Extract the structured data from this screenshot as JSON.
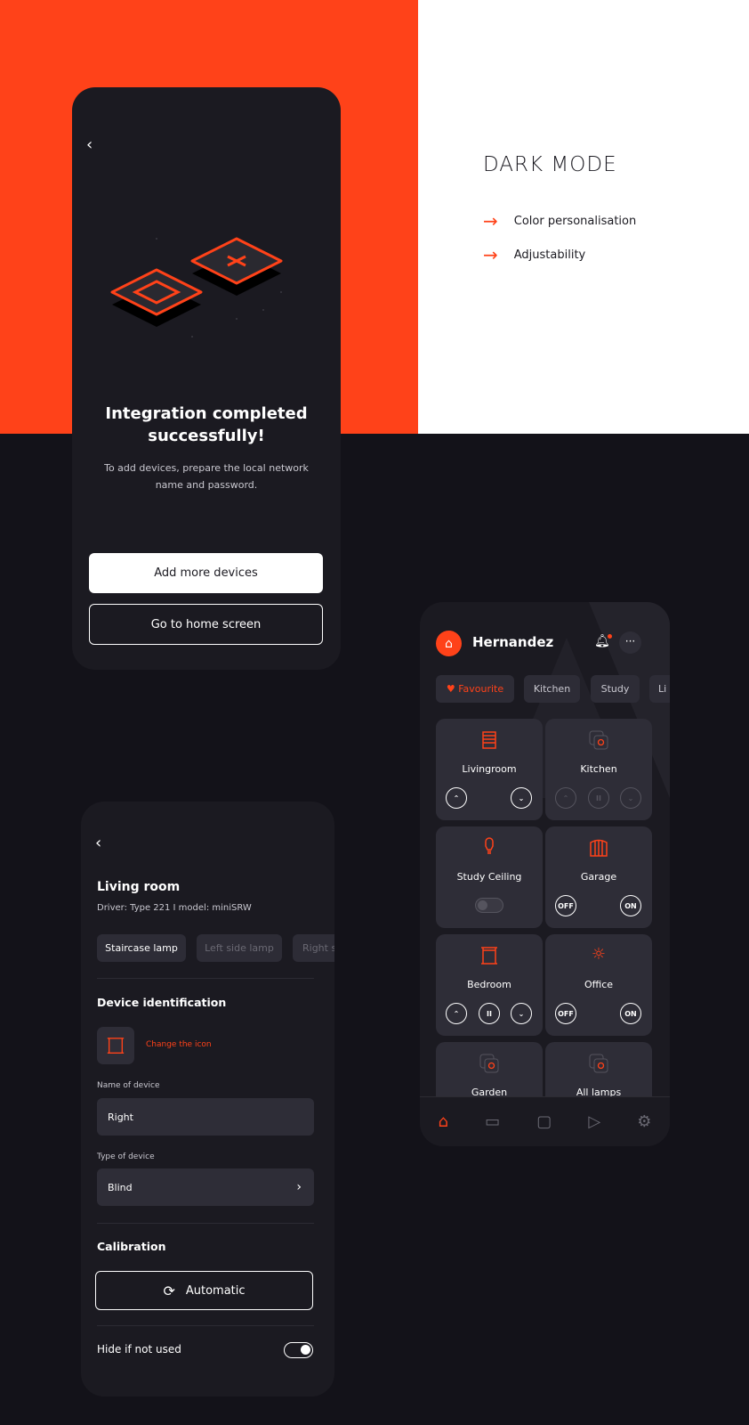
{
  "colors": {
    "accent": "#FF4219",
    "background": "#131219",
    "card": "#1b1a21",
    "tile": "#2e2d37"
  },
  "promo": {
    "title": "DARK MODE",
    "features": [
      "Color personalisation",
      "Adjustability"
    ]
  },
  "integration": {
    "title_line1": "Integration completed",
    "title_line2": "successfully!",
    "desc_line1": "To add devices, prepare the local network",
    "desc_line2": "name and password.",
    "add_button": "Add more devices",
    "home_button": "Go to home screen"
  },
  "home": {
    "user": "Hernandez",
    "tabs": [
      "Favourite",
      "Kitchen",
      "Study",
      "Li"
    ],
    "tiles": [
      {
        "name": "Livingroom",
        "icon": "blinds-icon",
        "controls": [
          "up",
          "down"
        ]
      },
      {
        "name": "Kitchen",
        "icon": "lamp-group-icon",
        "controls": [
          "up",
          "pause",
          "down"
        ],
        "disabled": true
      },
      {
        "name": "Study Ceiling",
        "icon": "bulb-icon",
        "toggle": false
      },
      {
        "name": "Garage",
        "icon": "garage-icon",
        "off": "OFF",
        "on": "ON"
      },
      {
        "name": "Bedroom",
        "icon": "window-icon",
        "controls": [
          "up",
          "pause",
          "down"
        ]
      },
      {
        "name": "Office",
        "icon": "sun-icon",
        "off": "OFF",
        "on": "ON"
      },
      {
        "name": "Garden",
        "icon": "lamp-group-icon"
      },
      {
        "name": "All lamps",
        "icon": "lamp-group-icon"
      }
    ],
    "nav": [
      "home",
      "tv",
      "chat",
      "play",
      "settings"
    ],
    "nav_active": "home"
  },
  "device": {
    "title": "Living room",
    "driver": "Driver: Type 221  I model: miniSRW",
    "chips": [
      "Staircase lamp",
      "Left side lamp",
      "Right s"
    ],
    "ident_heading": "Device identification",
    "change_icon": "Change the icon",
    "name_label": "Name of device",
    "name_value": "Right",
    "type_label": "Type of device",
    "type_value": "Blind",
    "calibration": "Calibration",
    "automatic": "Automatic",
    "hide_label": "Hide if not used",
    "hide_enabled": true
  }
}
